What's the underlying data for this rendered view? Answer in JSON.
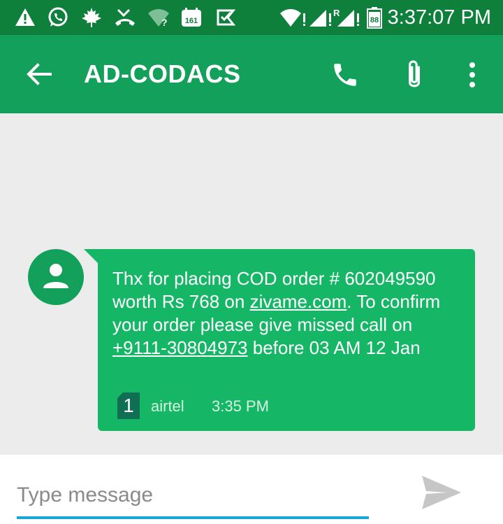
{
  "status_bar": {
    "time": "3:37:07 PM",
    "left_icons": [
      "warning-icon",
      "whatsapp-icon",
      "maple-leaf-icon",
      "missed-call-icon",
      "wifi-unknown-icon",
      "calendar-161-icon",
      "check-shield-icon"
    ],
    "right_icons": [
      "wifi-icon",
      "signal-icon",
      "roaming-signal-icon",
      "battery-icon"
    ],
    "calendar_badge": "161",
    "roaming_label": "R",
    "battery_level": "88"
  },
  "app_bar": {
    "title": "AD-CODACS",
    "background_color": "#13a05a"
  },
  "message": {
    "text_part1": "Thx for placing COD order # 602049590 worth Rs 768 on ",
    "link_site": "zivame.com",
    "text_part2": ". To confirm your order please give missed call on ",
    "link_phone": "+9111-30804973",
    "text_part3": " before 03 AM 12 Jan",
    "sim_slot": "1",
    "carrier": "airtel",
    "time": "3:35 PM",
    "bubble_color": "#15b766"
  },
  "compose": {
    "placeholder": "Type message",
    "value": ""
  }
}
